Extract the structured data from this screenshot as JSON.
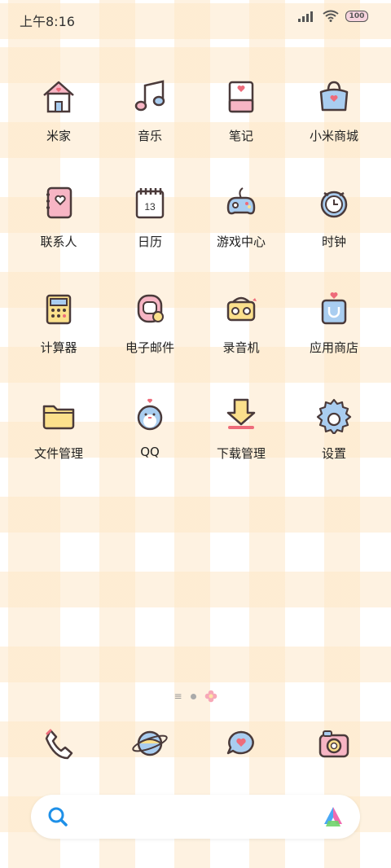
{
  "status": {
    "time": "上午8:16",
    "battery": "100"
  },
  "apps": [
    {
      "label": "米家",
      "icon": "home-icon"
    },
    {
      "label": "音乐",
      "icon": "music-note-icon"
    },
    {
      "label": "笔记",
      "icon": "notebook-icon"
    },
    {
      "label": "小米商城",
      "icon": "shopping-bag-icon"
    },
    {
      "label": "联系人",
      "icon": "contacts-book-icon"
    },
    {
      "label": "日历",
      "icon": "calendar-icon",
      "badge": "13"
    },
    {
      "label": "游戏中心",
      "icon": "gamepad-icon"
    },
    {
      "label": "时钟",
      "icon": "alarm-clock-icon"
    },
    {
      "label": "计算器",
      "icon": "calculator-icon"
    },
    {
      "label": "电子邮件",
      "icon": "email-icon"
    },
    {
      "label": "录音机",
      "icon": "recorder-icon"
    },
    {
      "label": "应用商店",
      "icon": "app-store-bag-icon"
    },
    {
      "label": "文件管理",
      "icon": "folder-icon"
    },
    {
      "label": "QQ",
      "icon": "penguin-icon"
    },
    {
      "label": "下载管理",
      "icon": "download-icon"
    },
    {
      "label": "设置",
      "icon": "gear-icon"
    }
  ],
  "dock": [
    {
      "icon": "phone-icon"
    },
    {
      "icon": "browser-planet-icon"
    },
    {
      "icon": "message-bubble-icon"
    },
    {
      "icon": "camera-icon"
    }
  ],
  "search": {
    "icon": "search-icon",
    "assistant": "assistant-icon"
  },
  "colors": {
    "stroke": "#4a3a3a",
    "pink": "#f7b5c4",
    "blue": "#a9cdf0",
    "yellow": "#fbe08c",
    "red": "#ee6b7a"
  }
}
